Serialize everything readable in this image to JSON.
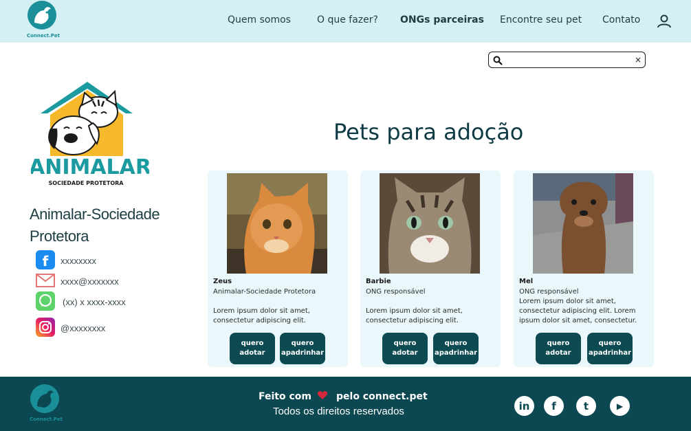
{
  "header": {
    "logo_text": "Connect.Pet",
    "nav": [
      {
        "label": "Quem somos"
      },
      {
        "label": "O que fazer?"
      },
      {
        "label": "ONGs parceiras"
      },
      {
        "label": "Encontre seu pet"
      },
      {
        "label": "Contato"
      }
    ],
    "active_nav": "ONGs parceiras",
    "user_icon": "user-icon"
  },
  "search": {
    "value": "",
    "placeholder": "",
    "clear_label": "×"
  },
  "ong": {
    "logo_title": "ANIMALAR",
    "logo_subtitle": "SOCIEDADE PROTETORA",
    "name": "Animalar-Sociedade Protetora",
    "contacts": [
      {
        "icon": "facebook-icon",
        "text": "xxxxxxxx"
      },
      {
        "icon": "mail-icon",
        "text": "xxxx@xxxxxxx"
      },
      {
        "icon": "whatsapp-icon",
        "text": "(xx) x xxxx-xxxx"
      },
      {
        "icon": "instagram-icon",
        "text": "@xxxxxxxx"
      }
    ]
  },
  "main": {
    "title": "Pets para adoção",
    "pets": [
      {
        "name": "Zeus",
        "ong": "Animalar-Sociedade Protetora",
        "description": "Lorem ipsum dolor sit amet, consectetur adipiscing elit.",
        "adopt_label": "quero adotar",
        "sponsor_label": "quero apadrinhar"
      },
      {
        "name": "Barbie",
        "ong": "ONG responsável",
        "description": "Lorem ipsum dolor sit amet, consectetur adipiscing elit.",
        "adopt_label": "quero adotar",
        "sponsor_label": "quero apadrinhar"
      },
      {
        "name": "Mel",
        "ong": "ONG responsável",
        "description": "Lorem ipsum dolor sit amet, consectetur adipiscing elit. Lorem ipsum dolor sit amet, consectetur.",
        "adopt_label": "quero adotar",
        "sponsor_label": "quero apadrinhar"
      }
    ]
  },
  "footer": {
    "logo_text": "Connect.Pet",
    "made_with": "Feito com",
    "made_by": "pelo connect.pet",
    "rights": "Todos os direitos reservados",
    "social": [
      {
        "icon": "linkedin-icon",
        "glyph": "in"
      },
      {
        "icon": "facebook-icon",
        "glyph": "f"
      },
      {
        "icon": "twitter-icon",
        "glyph": "t"
      },
      {
        "icon": "youtube-icon",
        "glyph": "▶"
      }
    ]
  },
  "colors": {
    "header_bg": "#d4f0f4",
    "footer_bg": "#0b4851",
    "button_bg": "#0d4a52",
    "card_bg": "#eaf8fb",
    "brand_teal": "#1b8f99",
    "heart": "#d7263d"
  }
}
